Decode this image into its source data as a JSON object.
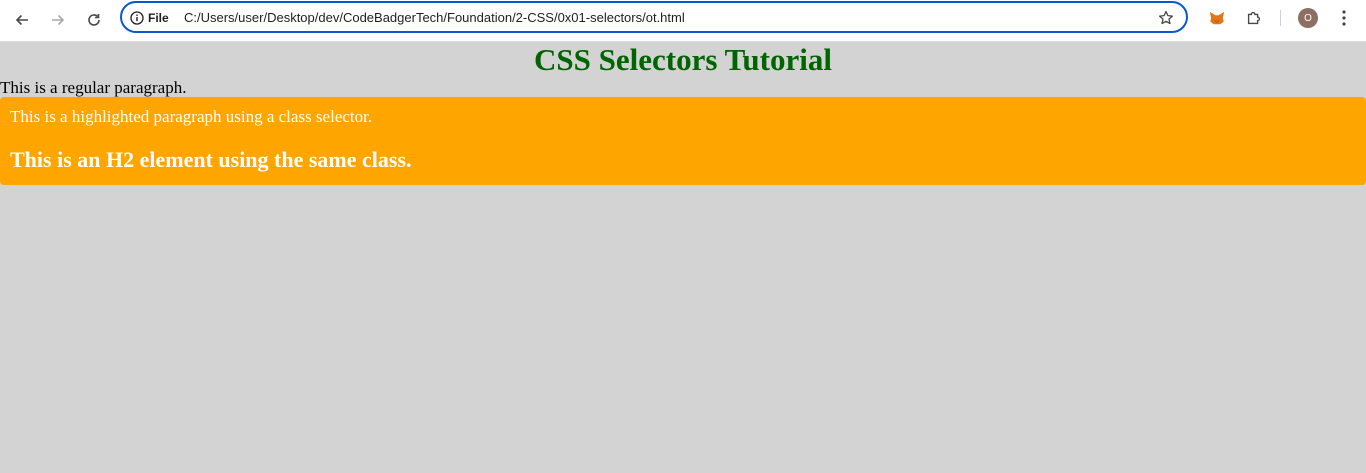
{
  "browser": {
    "back_icon": "arrow-left-icon",
    "forward_icon": "arrow-right-icon",
    "reload_icon": "reload-icon",
    "site_info_label": "File",
    "url": "C:/Users/user/Desktop/dev/CodeBadgerTech/Foundation/2-CSS/0x01-selectors/ot.html",
    "avatar_initial": "O",
    "accent_color": "#0b57d0"
  },
  "page": {
    "title": "CSS Selectors Tutorial",
    "regular_paragraph": "This is a regular paragraph.",
    "highlight_paragraph": "This is a highlighted paragraph using a class selector.",
    "highlight_h2": "This is an H2 element using the same class.",
    "colors": {
      "background": "#d3d3d3",
      "title": "#006400",
      "highlight_bg": "#ffa500",
      "highlight_text": "#ffffff"
    }
  }
}
